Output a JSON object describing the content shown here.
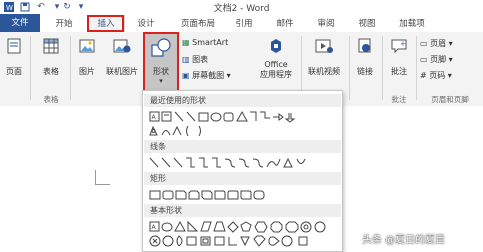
{
  "window": {
    "title": "文档2 - Word"
  },
  "tabs": [
    "文件",
    "开始",
    "插入",
    "设计",
    "页面布局",
    "引用",
    "邮件",
    "审阅",
    "视图",
    "加载项"
  ],
  "ribbon": {
    "page_label": "页面",
    "table_label": "表格",
    "picture_label": "图片",
    "online_picture_label": "联机图片",
    "shapes_label": "形状",
    "smartart_label": "SmartArt",
    "chart_label": "图表",
    "screenshot_label": "屏幕截图",
    "office_apps_label_1": "Office",
    "office_apps_label_2": "应用程序",
    "online_video_label": "联机视频",
    "link_label": "链接",
    "comment_label": "批注",
    "header_label": "页眉",
    "footer_label": "页脚",
    "page_number_label": "页码",
    "group_tables": "表格",
    "group_comments": "批注",
    "group_header_footer": "页眉和页脚"
  },
  "shapes_menu": {
    "recent": "最近使用的形状",
    "lines": "线条",
    "rectangles": "矩形",
    "basic": "基本形状"
  },
  "watermark": "头条 @夏日的夏目",
  "colors": {
    "accent": "#2b579a",
    "highlight": "#d9211e"
  }
}
